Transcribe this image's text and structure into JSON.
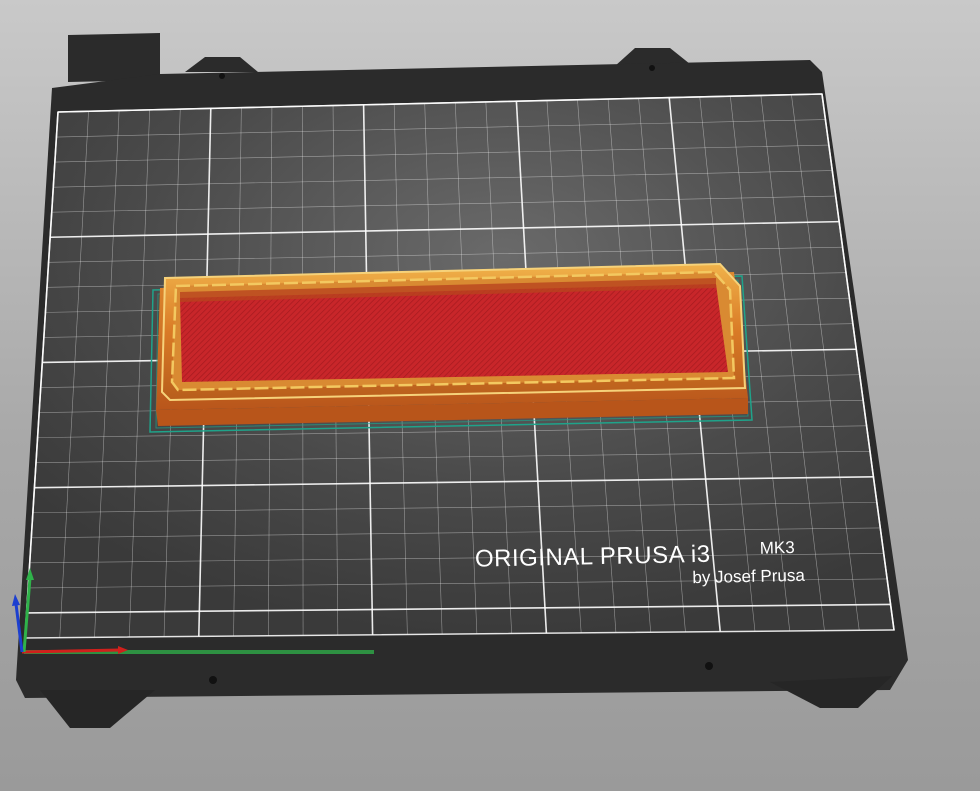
{
  "bed": {
    "logo_title": "ORIGINAL PRUSA i3",
    "logo_model": "MK3",
    "logo_byline": "by Josef Prusa"
  },
  "colors": {
    "background_top": "#c9c9c9",
    "background_bottom": "#9a9a9a",
    "bed_frame": "#2b2b2b",
    "bed_surface": "#4a4a4a",
    "grid_line": "#ffffff",
    "model_infill": "#c8262a",
    "model_perimeter": "#e08a2e",
    "model_highlight": "#f2c458",
    "skirt": "#1fa38a",
    "axis_x": "#d0201c",
    "axis_y": "#2fb34a",
    "axis_z": "#1c3fd0"
  },
  "icons": {
    "axes": "xyz-axes-gizmo",
    "screws": "bed-screw-holes"
  }
}
